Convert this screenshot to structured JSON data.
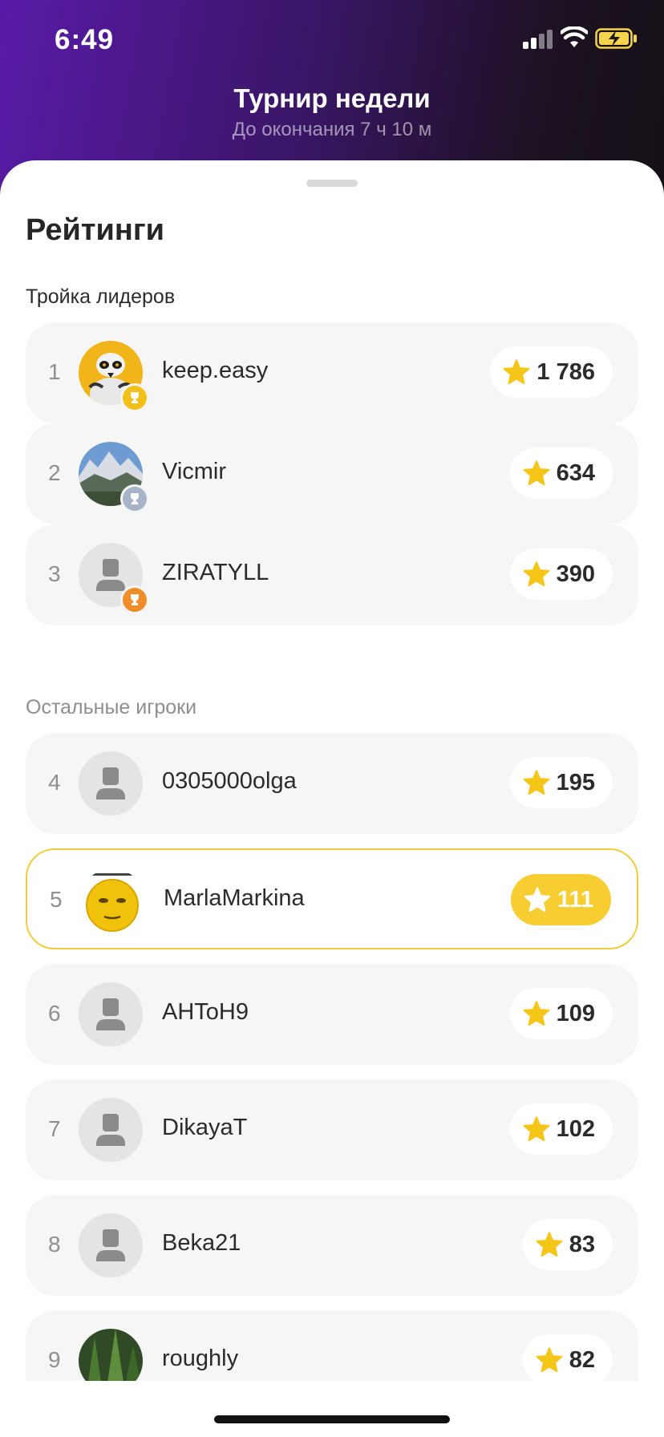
{
  "status_bar": {
    "time": "6:49",
    "icons": [
      "cellular-signal-icon",
      "wifi-icon",
      "battery-charging-icon"
    ]
  },
  "header": {
    "title": "Турнир недели",
    "subtitle": "До окончания 7 ч 10 м"
  },
  "sheet": {
    "title": "Рейтинги",
    "leaders_label": "Тройка лидеров",
    "others_label": "Остальные игроки"
  },
  "colors": {
    "accent_yellow": "#f8cd32",
    "star": "#f5c518",
    "gold_medal": "#f2c018",
    "silver_medal": "#a7b3c6",
    "bronze_medal": "#f08c2a",
    "highlight_border": "#f1cc3c"
  },
  "leaders": [
    {
      "rank": "1",
      "name": "keep.easy",
      "score": "1 786",
      "medal": "gold-trophy-icon",
      "avatar": "lemur-photo"
    },
    {
      "rank": "2",
      "name": "Vicmir",
      "score": "634",
      "medal": "silver-trophy-icon",
      "avatar": "mountain-photo"
    },
    {
      "rank": "3",
      "name": "ZIRATYLL",
      "score": "390",
      "medal": "bronze-trophy-icon",
      "avatar": "default-user-icon"
    }
  ],
  "players": [
    {
      "rank": "4",
      "name": "0305000olga",
      "score": "195",
      "avatar": "default-user-icon"
    },
    {
      "rank": "5",
      "name": "MarlaMarkina",
      "score": "111",
      "avatar": "smiley-moon-photo",
      "is_current_user": true
    },
    {
      "rank": "6",
      "name": "AHToH9",
      "score": "109",
      "avatar": "default-user-icon"
    },
    {
      "rank": "7",
      "name": "DikayaT",
      "score": "102",
      "avatar": "default-user-icon"
    },
    {
      "rank": "8",
      "name": "Beka21",
      "score": "83",
      "avatar": "default-user-icon"
    },
    {
      "rank": "9",
      "name": "roughly",
      "score": "82",
      "avatar": "forest-photo"
    }
  ]
}
